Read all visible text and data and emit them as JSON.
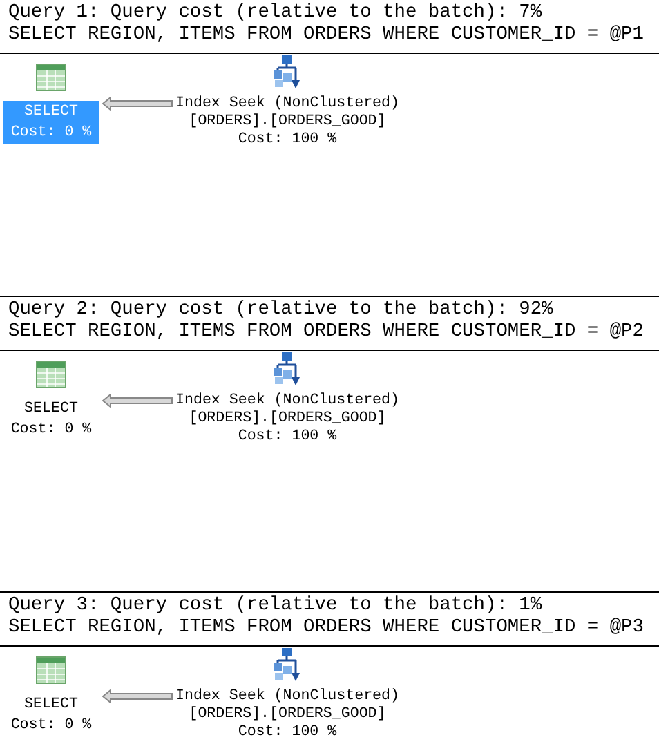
{
  "queries": [
    {
      "header": "Query 1: Query cost (relative to the batch): 7%",
      "statement": "SELECT REGION, ITEMS FROM ORDERS WHERE CUSTOMER_ID = @P1",
      "select": {
        "label": "SELECT",
        "cost": "Cost: 0 %",
        "selected": true
      },
      "seek": {
        "label": "Index Seek (NonClustered)",
        "object": "[ORDERS].[ORDERS_GOOD]",
        "cost": "Cost: 100 %"
      }
    },
    {
      "header": "Query 2: Query cost (relative to the batch): 92%",
      "statement": "SELECT REGION, ITEMS FROM ORDERS WHERE CUSTOMER_ID = @P2",
      "select": {
        "label": "SELECT",
        "cost": "Cost: 0 %",
        "selected": false
      },
      "seek": {
        "label": "Index Seek (NonClustered)",
        "object": "[ORDERS].[ORDERS_GOOD]",
        "cost": "Cost: 100 %"
      }
    },
    {
      "header": "Query 3: Query cost (relative to the batch): 1%",
      "statement": "SELECT REGION, ITEMS FROM ORDERS WHERE CUSTOMER_ID = @P3",
      "select": {
        "label": "SELECT",
        "cost": "Cost: 0 %",
        "selected": false
      },
      "seek": {
        "label": "Index Seek (NonClustered)",
        "object": "[ORDERS].[ORDERS_GOOD]",
        "cost": "Cost: 100 %"
      }
    }
  ]
}
